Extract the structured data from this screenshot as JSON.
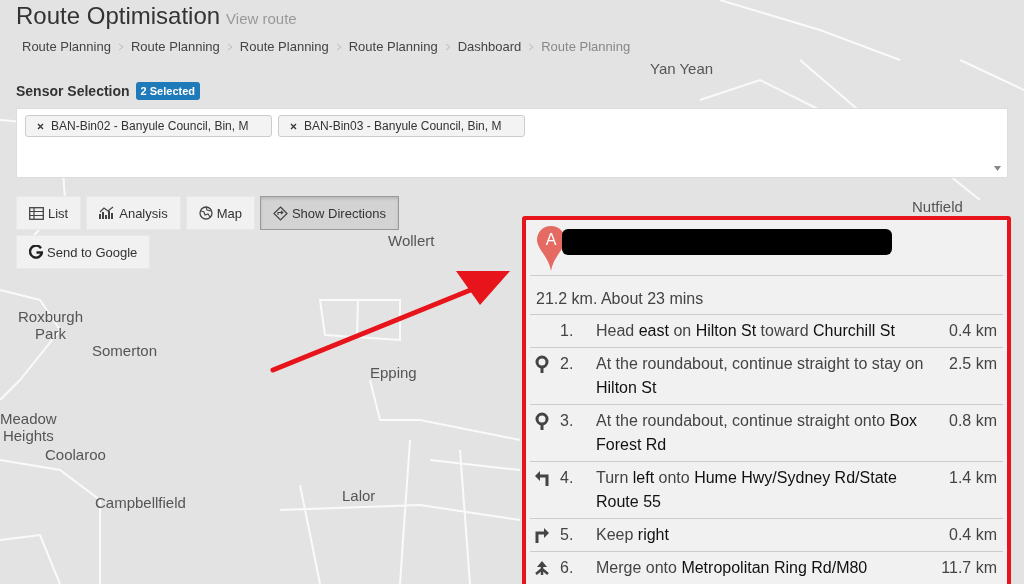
{
  "header": {
    "title": "Route Optimisation",
    "subtitle": "View route"
  },
  "breadcrumbs": [
    {
      "label": "Route Planning",
      "current": false
    },
    {
      "label": "Route Planning",
      "current": false
    },
    {
      "label": "Route Planning",
      "current": false
    },
    {
      "label": "Route Planning",
      "current": false
    },
    {
      "label": "Dashboard",
      "current": false
    },
    {
      "label": "Route Planning",
      "current": true
    }
  ],
  "sensor_selection": {
    "label": "Sensor Selection",
    "badge": "2 Selected",
    "chips": [
      "BAN-Bin02 - Banyule Council, Bin, M",
      "BAN-Bin03 - Banyule Council, Bin, M"
    ]
  },
  "toolbar": [
    {
      "label": "List",
      "kind": "table",
      "selected": false
    },
    {
      "label": "Analysis",
      "kind": "chart",
      "selected": false
    },
    {
      "label": "Map",
      "kind": "globe",
      "selected": false
    },
    {
      "label": "Show Directions",
      "kind": "directions",
      "selected": true
    },
    {
      "label": "Send to Google",
      "kind": "google",
      "selected": false
    }
  ],
  "map": {
    "labels": [
      "Yan Yean",
      "Nutfield",
      "Wollert",
      "Roxburgh\nPark",
      "Somerton",
      "Epping",
      "Meadow\nHeights",
      "Coolaroo",
      "Campbellfield",
      "Lalor"
    ]
  },
  "directions": {
    "marker": "A",
    "summary": "21.2 km. About 23 mins",
    "steps": [
      {
        "kind": "start",
        "number": "1.",
        "text": "Head **east** on **Hilton St** toward **Churchill St**",
        "distance": "0.4 km"
      },
      {
        "kind": "roundabout",
        "number": "2.",
        "text": "At the roundabout, continue straight to stay on **Hilton St**",
        "distance": "2.5 km"
      },
      {
        "kind": "roundabout",
        "number": "3.",
        "text": "At the roundabout, continue straight onto **Box Forest Rd**",
        "distance": "0.8 km"
      },
      {
        "kind": "turn-left",
        "number": "4.",
        "text": "Turn **left** onto **Hume Hwy/Sydney Rd/State Route 55**",
        "distance": "1.4 km"
      },
      {
        "kind": "keep-right",
        "number": "5.",
        "text": "Keep **right**",
        "distance": "0.4 km"
      },
      {
        "kind": "merge",
        "number": "6.",
        "text": "Merge onto **Metropolitan Ring Rd/M80**",
        "distance": "11.7 km"
      }
    ]
  }
}
